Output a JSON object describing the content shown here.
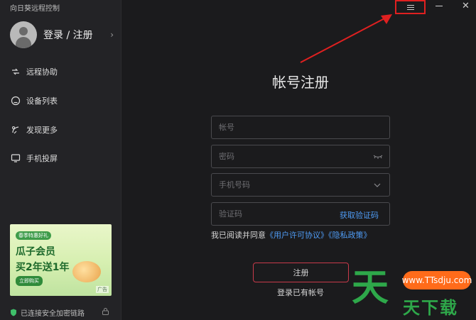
{
  "app": {
    "title": "向日葵远程控制"
  },
  "sidebar": {
    "user_label": "登录 / 注册",
    "items": [
      {
        "label": "远程协助",
        "icon": "remote-assist-icon"
      },
      {
        "label": "设备列表",
        "icon": "device-list-icon"
      },
      {
        "label": "发现更多",
        "icon": "discover-icon"
      },
      {
        "label": "手机投屏",
        "icon": "screen-mirror-icon"
      }
    ],
    "promo": {
      "tag": "春季特惠好礼",
      "title": "瓜子会员",
      "subtitle": "买2年送1年",
      "button": "立即购买",
      "ad_label": "广告"
    },
    "secure_text": "已连接安全加密链路"
  },
  "form": {
    "title": "帐号注册",
    "account_placeholder": "帐号",
    "password_placeholder": "密码",
    "phone_placeholder": "手机号码",
    "code_placeholder": "验证码",
    "get_code": "获取验证码",
    "agree_prefix": "我已阅读并同意",
    "license_link": "《用户许可协议》",
    "privacy_link": "《隐私政策》",
    "register_button": "注册",
    "login_link": "登录已有帐号"
  },
  "watermark": {
    "big_char": "天",
    "url": "www.TTsdju.com",
    "text": "天下载"
  },
  "colors": {
    "highlight": "#e02020",
    "link": "#4f9cf5",
    "register_border": "#c83a4a"
  }
}
